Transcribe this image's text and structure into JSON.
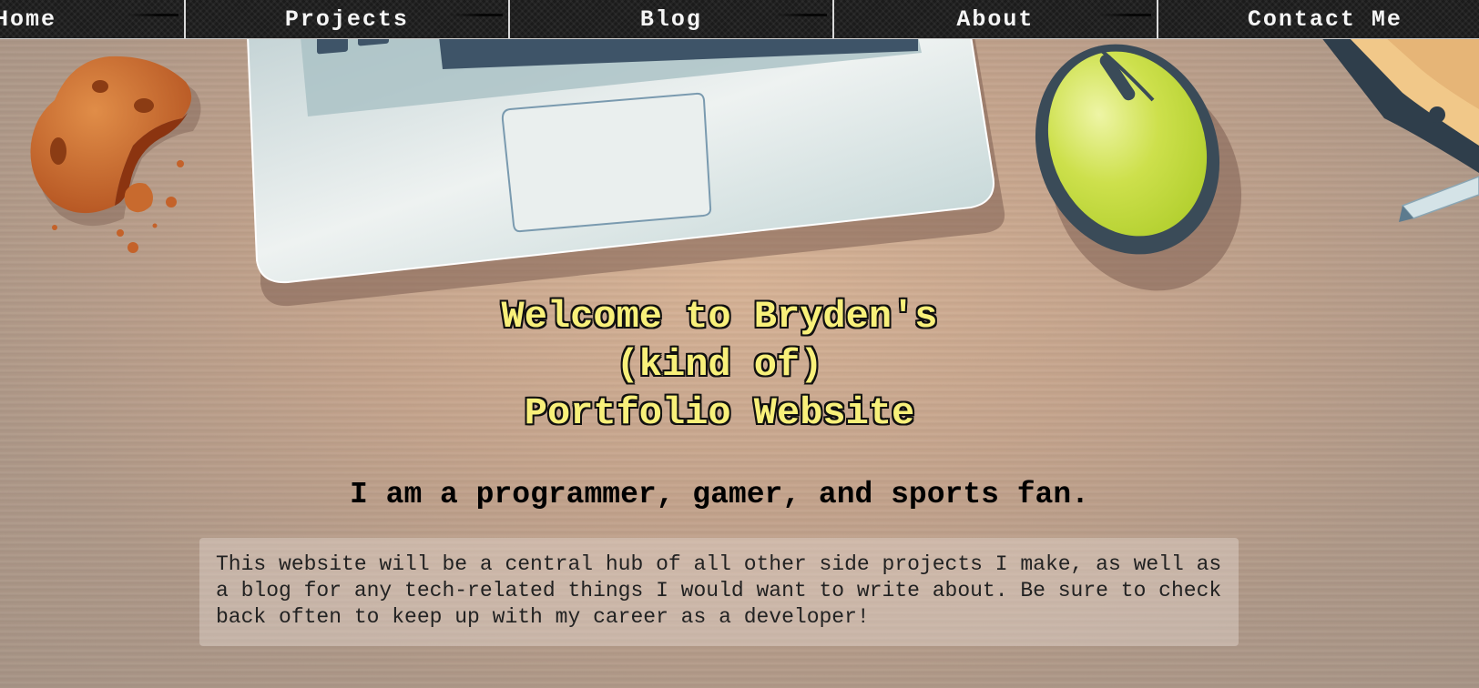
{
  "nav": {
    "items": [
      {
        "label": "Home"
      },
      {
        "label": "Projects"
      },
      {
        "label": "Blog"
      },
      {
        "label": "About"
      },
      {
        "label": "Contact Me"
      }
    ]
  },
  "hero": {
    "title_line1": "Welcome to Bryden's",
    "title_line2": "(kind of)",
    "title_line3": "Portfolio Website",
    "tagline": "I am a programmer, gamer, and sports fan.",
    "intro": "This website will be a central hub of all other side projects I make, as well as a blog for any tech-related things I would want to write about. Be sure to check back often to keep up with my career as a developer!"
  },
  "colors": {
    "title_fill": "#f8f07a",
    "nav_background": "#1b1b1b",
    "desk": "#c3a38c",
    "mouse_accent": "#c8e046"
  },
  "icons": [
    "cookie-icon",
    "laptop-illustration",
    "mouse-illustration",
    "notebook-illustration",
    "pen-illustration"
  ]
}
